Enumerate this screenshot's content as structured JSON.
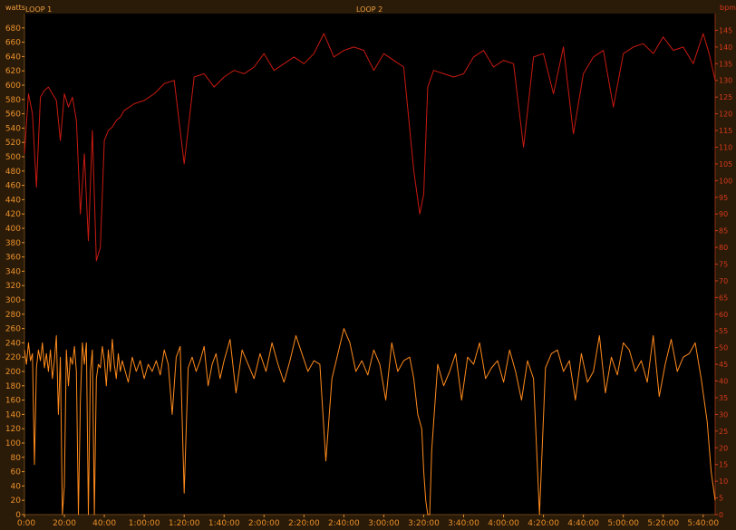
{
  "chart_data": {
    "type": "line",
    "left_axis_label": "watts",
    "right_axis_label": "bpm",
    "laps": [
      "LOOP 1",
      "LOOP 2"
    ],
    "x_ticks": [
      "0:00",
      "20:00",
      "40:00",
      "1:00:00",
      "1:20:00",
      "1:40:00",
      "2:00:00",
      "2:20:00",
      "2:40:00",
      "3:00:00",
      "3:20:00",
      "3:40:00",
      "4:00:00",
      "4:20:00",
      "4:40:00",
      "5:00:00",
      "5:20:00",
      "5:40:00"
    ],
    "x_tick_minutes": [
      0,
      20,
      40,
      60,
      80,
      100,
      120,
      140,
      160,
      180,
      200,
      220,
      240,
      260,
      280,
      300,
      320,
      340
    ],
    "xlim_minutes": [
      0,
      346
    ],
    "left_ylim": [
      0,
      700
    ],
    "left_yticks": [
      0,
      20,
      40,
      60,
      80,
      100,
      120,
      140,
      160,
      180,
      200,
      220,
      240,
      260,
      280,
      300,
      320,
      340,
      360,
      380,
      400,
      420,
      440,
      460,
      480,
      500,
      520,
      540,
      560,
      580,
      600,
      620,
      640,
      660,
      680
    ],
    "right_ylim": [
      0,
      150
    ],
    "right_yticks": [
      0,
      5,
      10,
      15,
      20,
      25,
      30,
      35,
      40,
      45,
      50,
      55,
      60,
      65,
      70,
      75,
      80,
      85,
      90,
      95,
      100,
      105,
      110,
      115,
      120,
      125,
      130,
      135,
      140,
      145
    ],
    "series": [
      {
        "name": "bpm",
        "axis": "right",
        "color": "#c81a10",
        "x": [
          0,
          2,
          4,
          6,
          8,
          10,
          12,
          14,
          16,
          18,
          20,
          22,
          24,
          26,
          28,
          30,
          32,
          34,
          36,
          38,
          40,
          42,
          44,
          46,
          48,
          50,
          55,
          60,
          65,
          70,
          75,
          80,
          85,
          90,
          95,
          100,
          105,
          110,
          115,
          120,
          125,
          130,
          135,
          140,
          145,
          150,
          155,
          160,
          165,
          170,
          175,
          180,
          185,
          190,
          195,
          198,
          200,
          202,
          205,
          210,
          215,
          220,
          225,
          230,
          235,
          240,
          245,
          250,
          255,
          260,
          265,
          270,
          275,
          280,
          285,
          290,
          295,
          300,
          305,
          310,
          315,
          320,
          325,
          330,
          335,
          340,
          343,
          346
        ],
        "y": [
          108,
          126,
          120,
          98,
          125,
          127,
          128,
          126,
          124,
          112,
          126,
          122,
          125,
          118,
          90,
          108,
          82,
          115,
          76,
          80,
          112,
          115,
          116,
          118,
          119,
          121,
          123,
          124,
          126,
          129,
          130,
          105,
          131,
          132,
          128,
          131,
          133,
          132,
          134,
          138,
          133,
          135,
          137,
          135,
          138,
          144,
          137,
          139,
          140,
          139,
          133,
          138,
          136,
          134,
          103,
          90,
          96,
          128,
          133,
          132,
          131,
          132,
          137,
          139,
          134,
          136,
          135,
          110,
          137,
          138,
          126,
          140,
          114,
          132,
          137,
          139,
          122,
          138,
          140,
          141,
          138,
          143,
          139,
          140,
          135,
          144,
          138,
          130
        ]
      },
      {
        "name": "watts",
        "axis": "left",
        "color": "#ff8a1c",
        "x": [
          0,
          1,
          2,
          3,
          4,
          5,
          6,
          7,
          8,
          9,
          10,
          11,
          12,
          13,
          14,
          15,
          16,
          17,
          18,
          19,
          20,
          21,
          22,
          23,
          24,
          25,
          26,
          27,
          28,
          29,
          30,
          31,
          32,
          33,
          34,
          35,
          36,
          37,
          38,
          39,
          40,
          41,
          42,
          43,
          44,
          45,
          46,
          47,
          48,
          49,
          50,
          52,
          54,
          56,
          58,
          60,
          62,
          64,
          66,
          68,
          70,
          72,
          74,
          76,
          78,
          80,
          82,
          84,
          86,
          88,
          90,
          92,
          94,
          96,
          98,
          100,
          103,
          106,
          109,
          112,
          115,
          118,
          121,
          124,
          127,
          130,
          133,
          136,
          139,
          142,
          145,
          148,
          151,
          154,
          157,
          160,
          163,
          166,
          169,
          172,
          175,
          178,
          181,
          184,
          187,
          190,
          193,
          195,
          197,
          199,
          200,
          201,
          202,
          203,
          204,
          205,
          207,
          210,
          213,
          216,
          219,
          222,
          225,
          228,
          231,
          234,
          237,
          240,
          243,
          246,
          249,
          252,
          255,
          258,
          261,
          264,
          267,
          270,
          273,
          276,
          279,
          282,
          285,
          288,
          291,
          294,
          297,
          300,
          303,
          306,
          309,
          312,
          315,
          318,
          321,
          324,
          327,
          330,
          333,
          336,
          339,
          342,
          344,
          346
        ],
        "y": [
          230,
          210,
          240,
          215,
          225,
          70,
          205,
          230,
          215,
          240,
          205,
          225,
          200,
          230,
          190,
          215,
          250,
          140,
          220,
          0,
          40,
          230,
          180,
          220,
          210,
          235,
          200,
          0,
          160,
          240,
          210,
          240,
          0,
          200,
          230,
          0,
          190,
          210,
          205,
          235,
          215,
          180,
          230,
          200,
          245,
          210,
          190,
          225,
          200,
          215,
          205,
          185,
          220,
          200,
          215,
          190,
          210,
          200,
          215,
          195,
          230,
          210,
          140,
          220,
          235,
          30,
          205,
          220,
          200,
          215,
          235,
          180,
          210,
          225,
          190,
          215,
          245,
          170,
          230,
          210,
          190,
          225,
          200,
          240,
          210,
          185,
          215,
          250,
          225,
          200,
          215,
          210,
          75,
          190,
          225,
          260,
          240,
          200,
          215,
          195,
          230,
          210,
          160,
          240,
          200,
          215,
          220,
          190,
          140,
          120,
          60,
          20,
          0,
          0,
          90,
          130,
          210,
          180,
          200,
          225,
          160,
          220,
          210,
          240,
          190,
          205,
          215,
          185,
          230,
          200,
          160,
          215,
          190,
          0,
          205,
          225,
          230,
          200,
          215,
          160,
          225,
          185,
          200,
          250,
          170,
          220,
          195,
          240,
          230,
          200,
          215,
          185,
          250,
          165,
          210,
          245,
          200,
          220,
          225,
          240,
          190,
          130,
          60,
          20
        ]
      }
    ]
  }
}
